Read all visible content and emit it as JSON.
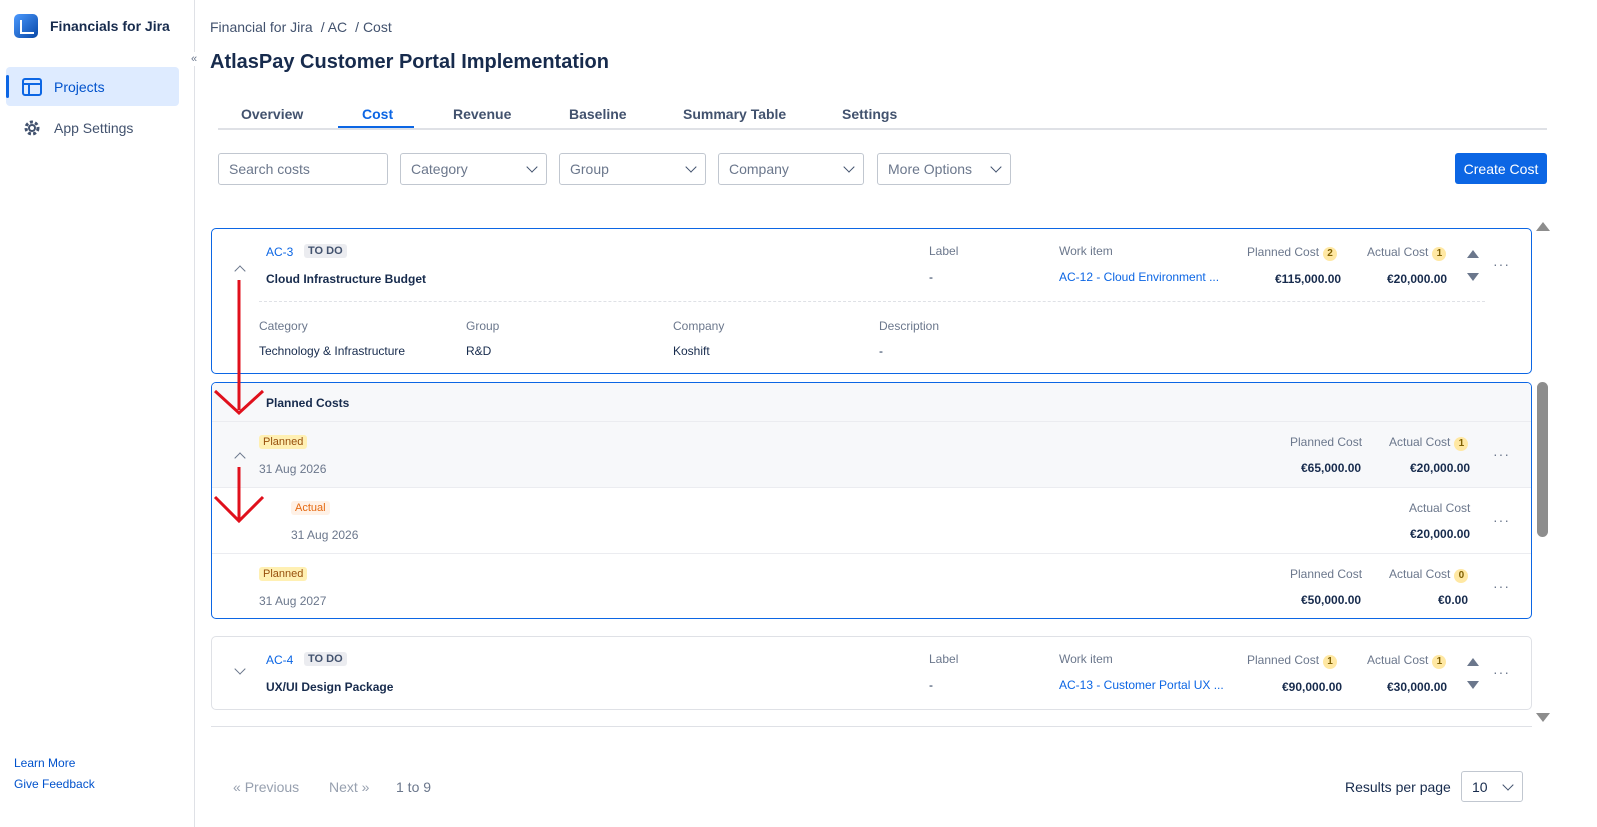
{
  "app": {
    "name": "Financials for Jira"
  },
  "sidebar": {
    "items": [
      {
        "label": "Projects",
        "icon": "table-icon",
        "active": true
      },
      {
        "label": "App Settings",
        "icon": "gear-icon",
        "active": false
      }
    ],
    "footer_links": [
      "Learn More",
      "Give Feedback"
    ]
  },
  "breadcrumb": [
    "Financial for Jira",
    "/ AC",
    "/ Cost"
  ],
  "page_title": "AtlasPay Customer Portal Implementation",
  "tabs": [
    "Overview",
    "Cost",
    "Revenue",
    "Baseline",
    "Summary Table",
    "Settings"
  ],
  "active_tab": "Cost",
  "filters": {
    "search_placeholder": "Search costs",
    "category": "Category",
    "group": "Group",
    "company": "Company",
    "more": "More Options"
  },
  "create_label": "Create Cost",
  "labels": {
    "label": "Label",
    "work_item": "Work item",
    "planned_cost": "Planned Cost",
    "actual_cost": "Actual Cost",
    "category": "Category",
    "group": "Group",
    "company": "Company",
    "description": "Description",
    "planned_costs_header": "Planned Costs"
  },
  "costs": [
    {
      "key": "AC-3",
      "status": "TO DO",
      "title": "Cloud Infrastructure Budget",
      "label": "-",
      "work_item": "AC-12 - Cloud Environment ...",
      "planned_count": "2",
      "actual_count": "1",
      "planned": "€115,000.00",
      "actual": "€20,000.00",
      "category": "Technology & Infrastructure",
      "group": "R&D",
      "company": "Koshift",
      "description": "-"
    },
    {
      "key": "AC-4",
      "status": "TO DO",
      "title": "UX/UI Design Package",
      "label": "-",
      "work_item": "AC-13 - Customer Portal UX ...",
      "planned_count": "1",
      "actual_count": "1",
      "planned": "€90,000.00",
      "actual": "€30,000.00"
    }
  ],
  "planned_rows": [
    {
      "tag": "Planned",
      "date": "31 Aug 2026",
      "planned": "€65,000.00",
      "actual": "€20,000.00",
      "actual_count": "1"
    },
    {
      "tag": "Actual",
      "date": "31 Aug 2026",
      "actual": "€20,000.00"
    },
    {
      "tag": "Planned",
      "date": "31 Aug 2027",
      "planned": "€50,000.00",
      "actual": "€0.00",
      "actual_count": "0"
    }
  ],
  "pagination": {
    "previous": "Previous",
    "next": "Next",
    "range": "1 to 9",
    "results_label": "Results per page",
    "per_page": "10"
  },
  "colors": {
    "accent": "#0c66e4",
    "annotation_arrow": "#e0101c"
  }
}
